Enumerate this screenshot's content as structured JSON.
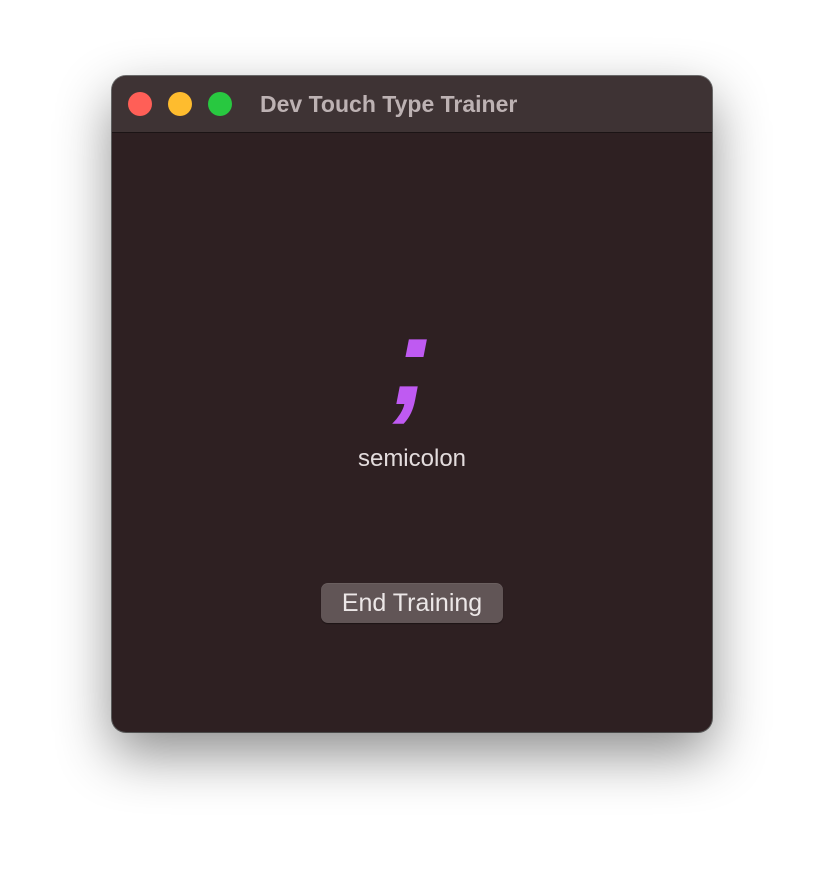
{
  "window": {
    "title": "Dev Touch Type Trainer",
    "traffic_lights": {
      "close_color": "#ff5f57",
      "minimize_color": "#febc2e",
      "zoom_color": "#28c840"
    }
  },
  "trainer": {
    "current_symbol": ";",
    "current_symbol_name": "semicolon",
    "symbol_color": "#bf5af2"
  },
  "actions": {
    "end_training_label": "End Training"
  }
}
